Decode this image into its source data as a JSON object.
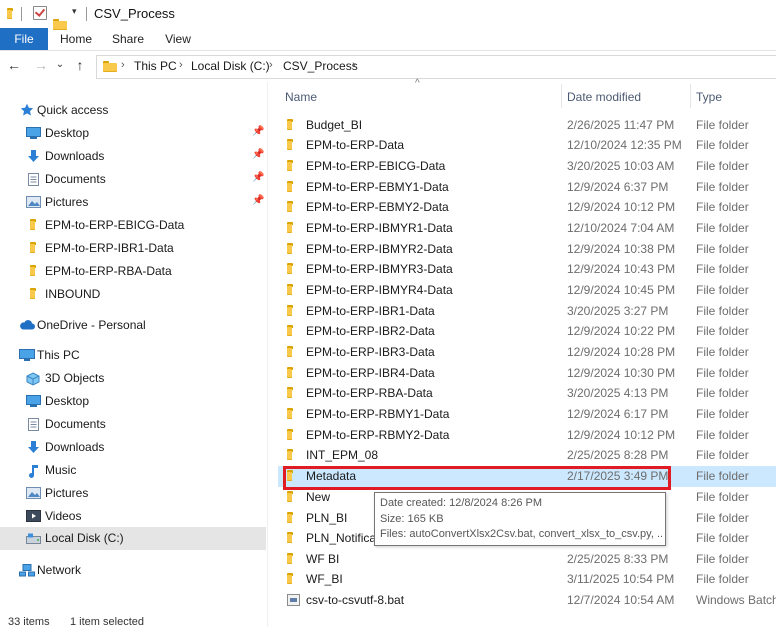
{
  "window": {
    "title": "CSV_Process",
    "quick_access_dropdown": "▾"
  },
  "ribbon": {
    "tabs": [
      "File",
      "Home",
      "Share",
      "View"
    ]
  },
  "nav": {
    "back": "←",
    "forward": "→",
    "recent": "⌄",
    "up": "↑"
  },
  "address": {
    "crumbs": [
      "This PC",
      "Local Disk (C:)",
      "CSV_Process"
    ],
    "arrows": [
      "›",
      "›",
      "›",
      "›"
    ]
  },
  "sidebar": {
    "quick_access": "Quick access",
    "quick_items": [
      {
        "label": "Desktop",
        "icon": "desktop-icon",
        "pinned": true
      },
      {
        "label": "Downloads",
        "icon": "downloads-icon",
        "pinned": true
      },
      {
        "label": "Documents",
        "icon": "documents-icon",
        "pinned": true
      },
      {
        "label": "Pictures",
        "icon": "pictures-icon",
        "pinned": true
      },
      {
        "label": "EPM-to-ERP-EBICG-Data",
        "icon": "folder-icon",
        "pinned": false
      },
      {
        "label": "EPM-to-ERP-IBR1-Data",
        "icon": "folder-icon",
        "pinned": false
      },
      {
        "label": "EPM-to-ERP-RBA-Data",
        "icon": "folder-icon",
        "pinned": false
      },
      {
        "label": "INBOUND",
        "icon": "folder-icon",
        "pinned": false
      }
    ],
    "onedrive": "OneDrive - Personal",
    "this_pc": "This PC",
    "pc_items": [
      {
        "label": "3D Objects",
        "icon": "3d-objects-icon"
      },
      {
        "label": "Desktop",
        "icon": "desktop-icon"
      },
      {
        "label": "Documents",
        "icon": "documents-icon"
      },
      {
        "label": "Downloads",
        "icon": "downloads-icon"
      },
      {
        "label": "Music",
        "icon": "music-icon"
      },
      {
        "label": "Pictures",
        "icon": "pictures-icon"
      },
      {
        "label": "Videos",
        "icon": "videos-icon"
      },
      {
        "label": "Local Disk (C:)",
        "icon": "local-disk-icon",
        "selected": true
      }
    ],
    "network": "Network",
    "pin_glyph": "📌"
  },
  "columns": {
    "name": "Name",
    "date": "Date modified",
    "type": "Type",
    "sort_glyph": "^"
  },
  "files": [
    {
      "name": "Budget_BI",
      "date": "2/26/2025 11:47 PM",
      "type": "File folder"
    },
    {
      "name": "EPM-to-ERP-Data",
      "date": "12/10/2024 12:35 PM",
      "type": "File folder"
    },
    {
      "name": "EPM-to-ERP-EBICG-Data",
      "date": "3/20/2025 10:03 AM",
      "type": "File folder"
    },
    {
      "name": "EPM-to-ERP-EBMY1-Data",
      "date": "12/9/2024 6:37 PM",
      "type": "File folder"
    },
    {
      "name": "EPM-to-ERP-EBMY2-Data",
      "date": "12/9/2024 10:12 PM",
      "type": "File folder"
    },
    {
      "name": "EPM-to-ERP-IBMYR1-Data",
      "date": "12/10/2024 7:04 AM",
      "type": "File folder"
    },
    {
      "name": "EPM-to-ERP-IBMYR2-Data",
      "date": "12/9/2024 10:38 PM",
      "type": "File folder"
    },
    {
      "name": "EPM-to-ERP-IBMYR3-Data",
      "date": "12/9/2024 10:43 PM",
      "type": "File folder"
    },
    {
      "name": "EPM-to-ERP-IBMYR4-Data",
      "date": "12/9/2024 10:45 PM",
      "type": "File folder"
    },
    {
      "name": "EPM-to-ERP-IBR1-Data",
      "date": "3/20/2025 3:27 PM",
      "type": "File folder"
    },
    {
      "name": "EPM-to-ERP-IBR2-Data",
      "date": "12/9/2024 10:22 PM",
      "type": "File folder"
    },
    {
      "name": "EPM-to-ERP-IBR3-Data",
      "date": "12/9/2024 10:28 PM",
      "type": "File folder"
    },
    {
      "name": "EPM-to-ERP-IBR4-Data",
      "date": "12/9/2024 10:30 PM",
      "type": "File folder"
    },
    {
      "name": "EPM-to-ERP-RBA-Data",
      "date": "3/20/2025 4:13 PM",
      "type": "File folder"
    },
    {
      "name": "EPM-to-ERP-RBMY1-Data",
      "date": "12/9/2024 6:17 PM",
      "type": "File folder"
    },
    {
      "name": "EPM-to-ERP-RBMY2-Data",
      "date": "12/9/2024 10:12 PM",
      "type": "File folder"
    },
    {
      "name": "INT_EPM_08",
      "date": "2/25/2025 8:28 PM",
      "type": "File folder"
    },
    {
      "name": "Metadata",
      "date": "2/17/2025 3:49 PM",
      "type": "File folder",
      "selected": true
    },
    {
      "name": "New",
      "date": "",
      "type": "File folder"
    },
    {
      "name": "PLN_BI",
      "date": "",
      "type": "File folder"
    },
    {
      "name": "PLN_Notificati",
      "date": "",
      "type": "File folder"
    },
    {
      "name": "WF BI",
      "date": "2/25/2025 8:33 PM",
      "type": "File folder"
    },
    {
      "name": "WF_BI",
      "date": "3/11/2025 10:54 PM",
      "type": "File folder"
    },
    {
      "name": "csv-to-csvutf-8.bat",
      "date": "12/7/2024 10:54 AM",
      "type": "Windows Batch",
      "icon": "bat"
    }
  ],
  "tooltip": {
    "created": "Date created: 12/8/2024 8:26 PM",
    "size": "Size: 165 KB",
    "files": "Files: autoConvertXlsx2Csv.bat, convert_xlsx_to_csv.py, ..."
  },
  "status": {
    "items": "33 items",
    "selected": "1 item selected"
  },
  "colors": {
    "accent": "#1f6fc4",
    "selection": "#cce8ff",
    "highlight": "#e01b24"
  }
}
